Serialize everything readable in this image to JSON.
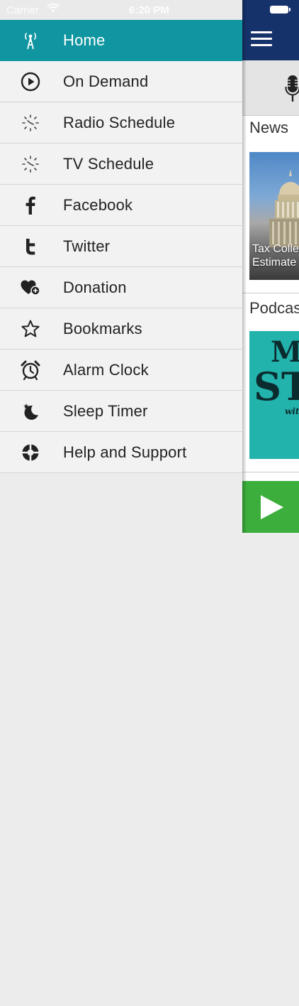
{
  "status_bar": {
    "carrier": "Carrier",
    "time": "6:20 PM"
  },
  "drawer": {
    "items": [
      {
        "label": "Home",
        "icon": "radio-tower-icon",
        "active": true
      },
      {
        "label": "On Demand",
        "icon": "play-circle-icon",
        "active": false
      },
      {
        "label": "Radio Schedule",
        "icon": "clock-icon",
        "active": false
      },
      {
        "label": "TV Schedule",
        "icon": "clock-icon",
        "active": false
      },
      {
        "label": "Facebook",
        "icon": "facebook-icon",
        "active": false
      },
      {
        "label": "Twitter",
        "icon": "twitter-icon",
        "active": false
      },
      {
        "label": "Donation",
        "icon": "heart-plus-icon",
        "active": false
      },
      {
        "label": "Bookmarks",
        "icon": "star-icon",
        "active": false
      },
      {
        "label": "Alarm Clock",
        "icon": "alarm-clock-icon",
        "active": false
      },
      {
        "label": "Sleep Timer",
        "icon": "moon-star-icon",
        "active": false
      },
      {
        "label": "Help and Support",
        "icon": "lifebuoy-icon",
        "active": false
      }
    ]
  },
  "main": {
    "news_title": "News",
    "news_caption_line1": "Tax Colle",
    "news_caption_line2": "Estimate",
    "podcast_title": "Podcas",
    "podcast_art_text": "M",
    "podcast_art_text2": "ST",
    "podcast_art_text3": "wit"
  },
  "colors": {
    "accent": "#0f96a0",
    "header": "#16326a",
    "play": "#3cae3c"
  }
}
